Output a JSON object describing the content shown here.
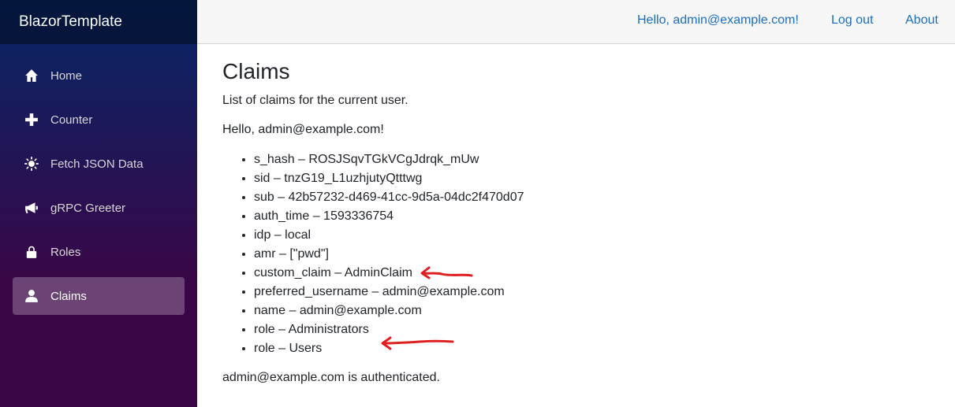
{
  "brand": "BlazorTemplate",
  "nav": [
    {
      "label": "Home",
      "icon": "home-icon"
    },
    {
      "label": "Counter",
      "icon": "plus-icon"
    },
    {
      "label": "Fetch JSON Data",
      "icon": "sun-icon"
    },
    {
      "label": "gRPC Greeter",
      "icon": "bullhorn-icon"
    },
    {
      "label": "Roles",
      "icon": "lock-icon"
    },
    {
      "label": "Claims",
      "icon": "person-icon",
      "active": true
    }
  ],
  "topbar": {
    "greeting": "Hello, admin@example.com!",
    "logout": "Log out",
    "about": "About"
  },
  "page": {
    "title": "Claims",
    "description": "List of claims for the current user.",
    "hello": "Hello, admin@example.com!",
    "claims": [
      "s_hash – ROSJSqvTGkVCgJdrqk_mUw",
      "sid – tnzG19_L1uzhjutyQtttwg",
      "sub – 42b57232-d469-41cc-9d5a-04dc2f470d07",
      "auth_time – 1593336754",
      "idp – local",
      "amr – [\"pwd\"]",
      "custom_claim – AdminClaim",
      "preferred_username – admin@example.com",
      "name – admin@example.com",
      "role – Administrators",
      "role – Users"
    ],
    "authenticated": "admin@example.com is authenticated."
  },
  "colors": {
    "link": "#1b6ec2",
    "annotation_arrow": "#e02020"
  }
}
